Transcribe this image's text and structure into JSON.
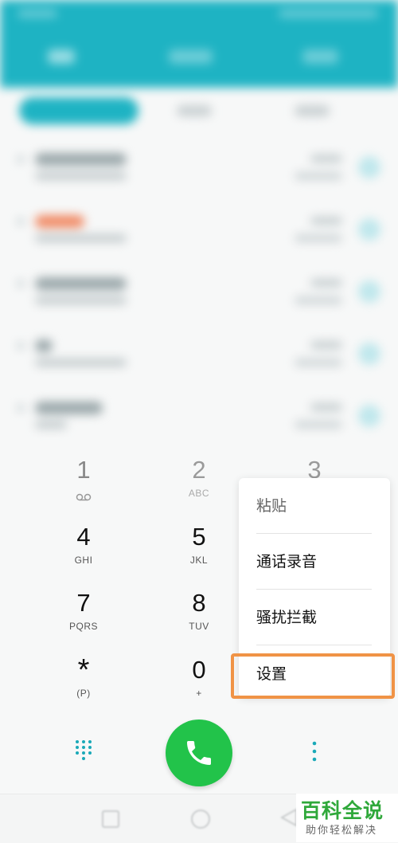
{
  "dialpad": {
    "keys": [
      {
        "digit": "1",
        "letters": ""
      },
      {
        "digit": "2",
        "letters": "ABC"
      },
      {
        "digit": "3",
        "letters": ""
      },
      {
        "digit": "4",
        "letters": "GHI"
      },
      {
        "digit": "5",
        "letters": "JKL"
      },
      {
        "digit": "7",
        "letters": "PQRS"
      },
      {
        "digit": "8",
        "letters": "TUV"
      },
      {
        "digit": "*",
        "letters": "(P)"
      },
      {
        "digit": "0",
        "letters": "+"
      }
    ]
  },
  "menu": {
    "items": [
      "粘贴",
      "通话录音",
      "骚扰拦截",
      "设置"
    ]
  },
  "watermark": {
    "title": "百科全说",
    "subtitle": "助你轻松解决"
  },
  "colors": {
    "accent": "#1eb3c3",
    "call_green": "#22c34a",
    "highlight_orange": "#f09346"
  },
  "icons": {
    "voicemail": "voicemail-icon",
    "phone": "phone-icon",
    "dialpad": "dialpad-grid-icon",
    "more": "more-vertical-icon"
  }
}
